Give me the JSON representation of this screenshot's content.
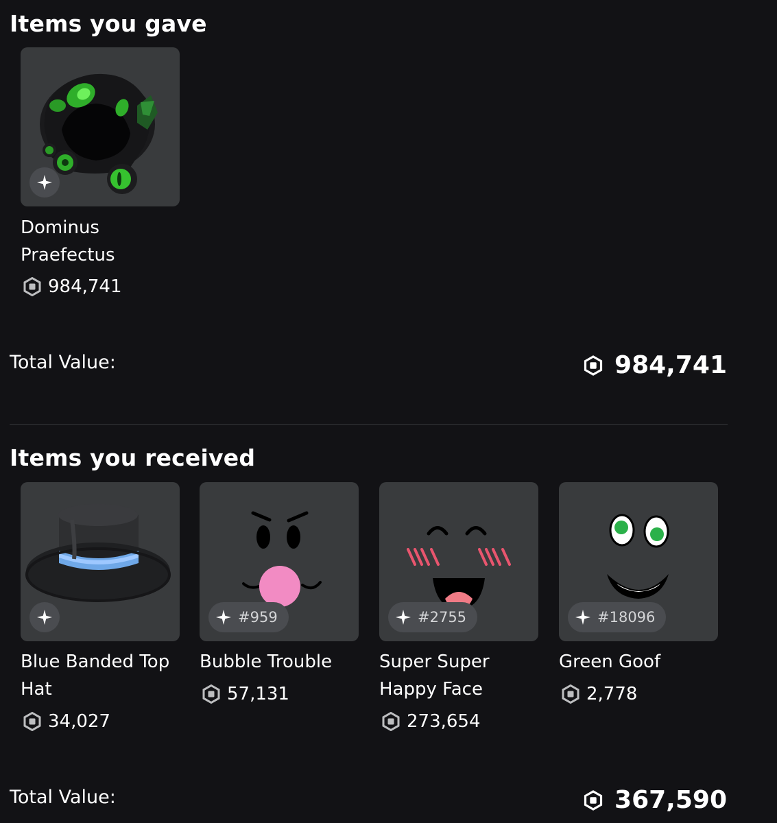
{
  "gave": {
    "title": "Items you gave",
    "items": [
      {
        "name": "Dominus Praefectus",
        "price": "984,741",
        "serial": ""
      }
    ],
    "total_label": "Total Value:",
    "total_value": "984,741"
  },
  "received": {
    "title": "Items you received",
    "items": [
      {
        "name": "Blue Banded Top Hat",
        "price": "34,027",
        "serial": ""
      },
      {
        "name": "Bubble Trouble",
        "price": "57,131",
        "serial": "#959"
      },
      {
        "name": "Super Super Happy Face",
        "price": "273,654",
        "serial": "#2755"
      },
      {
        "name": "Green Goof",
        "price": "2,778",
        "serial": "#18096"
      }
    ],
    "total_label": "Total Value:",
    "total_value": "367,590"
  },
  "icons": {
    "limited_badge": "sparkle-icon",
    "currency": "robux-icon"
  },
  "colors": {
    "background": "#121215",
    "card": "#393b3d",
    "badge": "#4a4c50",
    "text": "#ffffff"
  }
}
